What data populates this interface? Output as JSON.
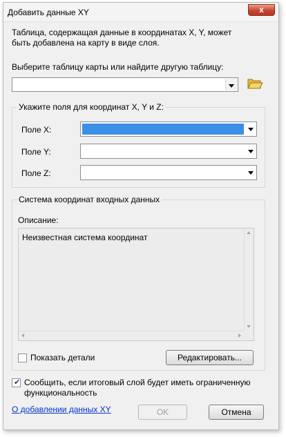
{
  "window": {
    "title": "Добавить данные XY",
    "close_glyph": "x"
  },
  "intro_text_line1": "Таблица, содержащая данные в координатах X, Y, может",
  "intro_text_line2": "быть добавлена на карту в виде слоя.",
  "table_select": {
    "label": "Выберите таблицу карты или найдите другую таблицу:",
    "value": "",
    "browse_icon": "folder-open-icon"
  },
  "fields_group": {
    "label": "Укажите поля для координат X, Y и Z:",
    "x_label": "Поле X:",
    "x_value": "",
    "y_label": "Поле Y:",
    "y_value": "",
    "z_label": "Поле Z:",
    "z_value": ""
  },
  "coord_group": {
    "label": "Система координат входных данных",
    "description_label": "Описание:",
    "description_text": "Неизвестная система координат",
    "show_details_label": "Показать детали",
    "show_details_checked": false,
    "edit_button": "Редактировать..."
  },
  "warn_checkbox": {
    "label_line1": "Сообщить, если итоговый слой будет иметь ограниченную",
    "label_line2": "функциональность",
    "checked": true
  },
  "help_link": "О добавлении данных XY",
  "ok_button": "OK",
  "cancel_button": "Отмена",
  "colors": {
    "selection": "#3c8fe6",
    "link": "#0033cc",
    "close": "#c8452e"
  }
}
